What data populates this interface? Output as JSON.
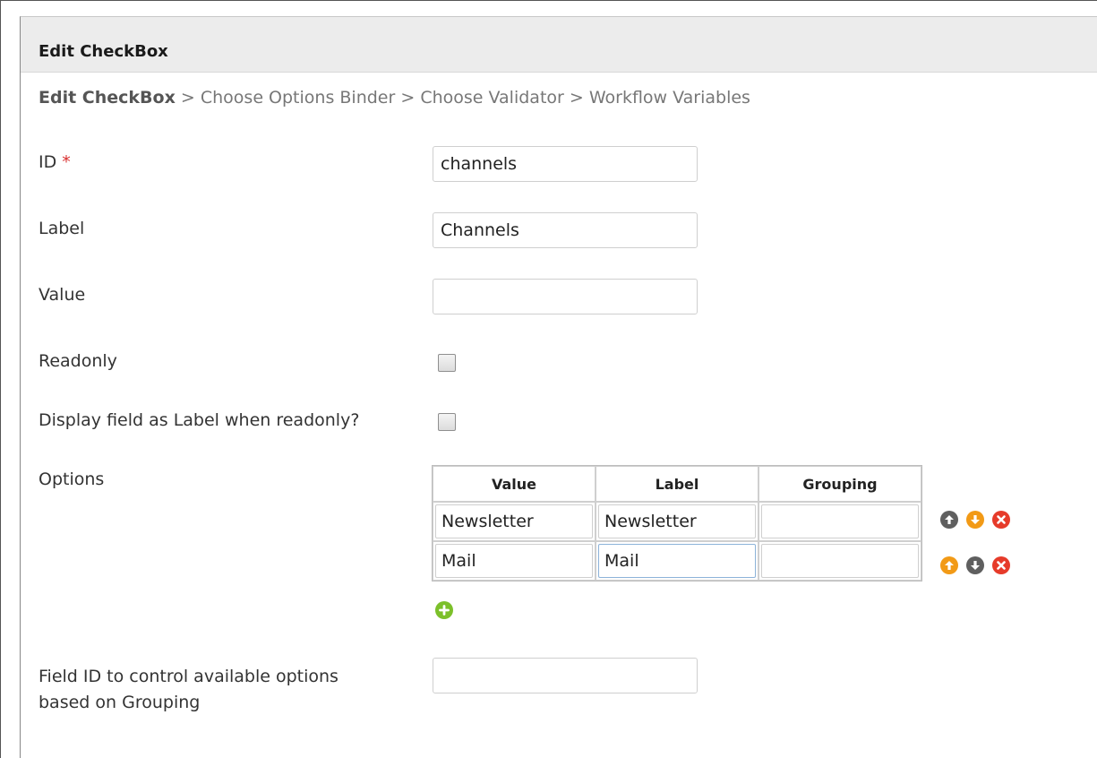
{
  "panel": {
    "title": "Edit CheckBox"
  },
  "breadcrumb": {
    "current": "Edit CheckBox",
    "separator": ">",
    "steps": [
      "Choose Options Binder",
      "Choose Validator",
      "Workflow Variables"
    ]
  },
  "form": {
    "id": {
      "label": "ID",
      "required_marker": "*",
      "value": "channels"
    },
    "label": {
      "label": "Label",
      "value": "Channels"
    },
    "value": {
      "label": "Value",
      "value": ""
    },
    "readonly": {
      "label": "Readonly",
      "checked": false
    },
    "display_as_label": {
      "label": "Display field as Label when readonly?",
      "checked": false
    },
    "options": {
      "label": "Options",
      "columns": [
        "Value",
        "Label",
        "Grouping"
      ],
      "rows": [
        {
          "value": "Newsletter",
          "label": "Newsletter",
          "grouping": ""
        },
        {
          "value": "Mail",
          "label": "Mail",
          "grouping": ""
        }
      ]
    },
    "field_id_control": {
      "label_line1": "Field ID to control available options",
      "label_line2": "based on Grouping",
      "value": ""
    }
  },
  "colors": {
    "required": "#d93030",
    "orange_icon": "#f29a16",
    "gray_icon": "#5f5f5f",
    "delete_icon": "#e63b2a",
    "add_icon": "#7cc02a"
  },
  "icons": [
    "move-up-icon",
    "move-down-icon",
    "delete-row-icon",
    "add-row-icon"
  ]
}
